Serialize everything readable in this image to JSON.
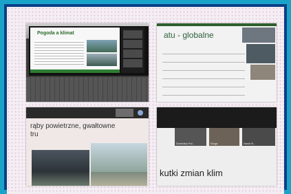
{
  "photos": [
    {
      "slide_title": "Pogoda a klimat"
    },
    {
      "slide_title": "atu - globalne"
    },
    {
      "slide_title": "rąby powietrzne, gwałtowne",
      "slide_title_line2": "tru"
    },
    {
      "participant_names": [
        "Dominika Pol...",
        "Kinga",
        "David B..."
      ],
      "slide_title": "kutki zmian klim"
    }
  ]
}
